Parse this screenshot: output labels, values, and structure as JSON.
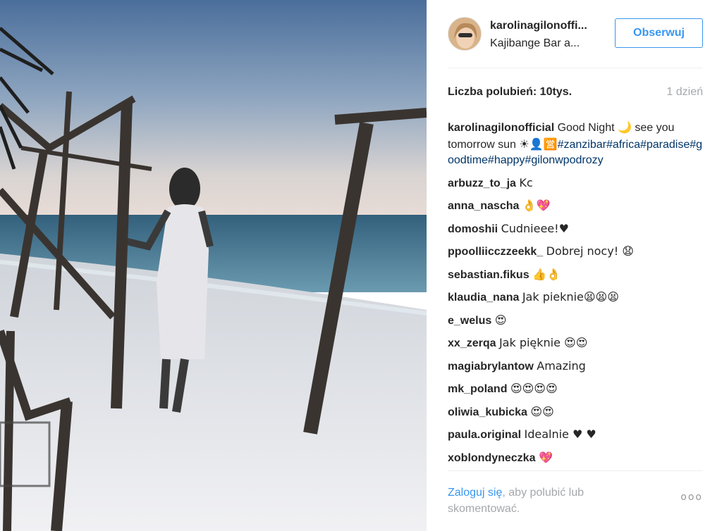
{
  "post": {
    "author": "karolinagilonoffi...",
    "location": "Kajibange Bar a...",
    "follow_label": "Obserwuj",
    "likes_label": "Liczba polubień:",
    "likes_count": "10tys.",
    "time": "1 dzień"
  },
  "caption": {
    "user": "karolinagilonofficial",
    "text": "Good Night",
    "emoji_moon": "🌙",
    "text2": "see you tomorrow sun",
    "emoji_sun": "☀👤🈺",
    "tags": "#zanzibar#africa#paradise#goodtime#happy#gilonwpodrozy"
  },
  "comments": [
    {
      "user": "arbuzz_to_ja",
      "text": "Kc"
    },
    {
      "user": "anna_nascha",
      "text": "👌💖"
    },
    {
      "user": "domoshii",
      "text": "Cudnieee!♥"
    },
    {
      "user": "ppoolliicczzeekk_",
      "text": "Dobrej nocy! 😧"
    },
    {
      "user": "sebastian.fikus",
      "text": "👍👌"
    },
    {
      "user": "klaudia_nana",
      "text": "Jak pieknie😫😫😫"
    },
    {
      "user": "e_welus",
      "text": "😍"
    },
    {
      "user": "xx_zerqa",
      "text": "Jak pięknie 😍😍"
    },
    {
      "user": "magiabrylantow",
      "text": "Amazing"
    },
    {
      "user": "mk_poland",
      "text": "😍😍😍😍"
    },
    {
      "user": "oliwia_kubicka",
      "text": "😍😍"
    },
    {
      "user": "paula.original",
      "text": "Idealnie ♥ ♥"
    },
    {
      "user": "xoblondyneczka",
      "text": "💖"
    }
  ],
  "footer": {
    "login_link": "Zaloguj się",
    "login_text": ", aby polubić lub skomentować.",
    "more": "ooo"
  },
  "colors": {
    "accent": "#3897f0",
    "hashtag": "#003569",
    "muted": "#a5a7aa"
  }
}
